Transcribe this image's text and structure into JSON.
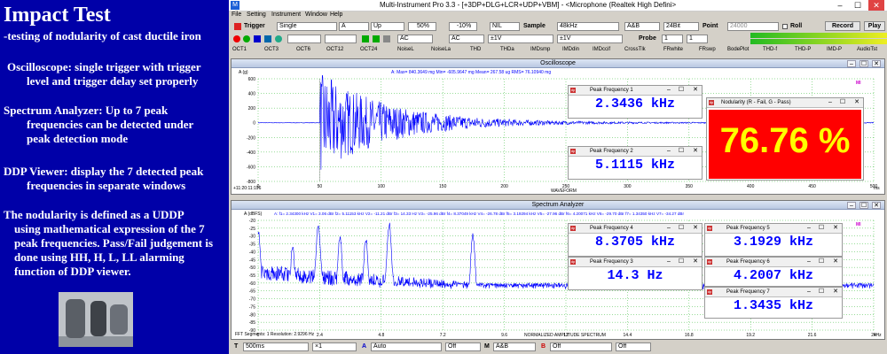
{
  "left_panel": {
    "title": "Impact Test",
    "subtitle": "-testing of nodularity of cast ductile iron",
    "osc_head": "Oscilloscope: single trigger with trigger",
    "osc_tail": "level and trigger delay set properly",
    "spec_head": "Spectrum Analyzer: Up to 7 peak",
    "spec_tail1": "frequencies can be detected under",
    "spec_tail2": "peak detection mode",
    "ddp_head": "DDP Viewer: display the 7 detected peak",
    "ddp_tail": "frequencies in separate windows",
    "nod_head": "The nodularity is defined as a UDDP",
    "nod_tail1": "using mathematical expression of the 7",
    "nod_tail2": "peak frequencies. Pass/Fail judgement is",
    "nod_tail3": "done using HH, H, L, LL alarming",
    "nod_tail4": "function of DDP viewer."
  },
  "titlebar": {
    "app_icon": "M",
    "title": "Multi-Instrument Pro 3.3    -  [+3DP+DLG+LCR+UDP+VBM]  -  <Microphone (Realtek High Defini>",
    "minimize": "–",
    "maximize": "☐",
    "close": "✕"
  },
  "menu": [
    "File",
    "Setting",
    "Instrument",
    "Window",
    "Help"
  ],
  "toolbar": {
    "trigger_label": "Trigger",
    "trigger_mode": "Single",
    "trigger_channel": "A",
    "trigger_edge": "Up",
    "trigger_level": "50%",
    "trigger_delay": "-10%",
    "nil": "NIL",
    "sample_label": "Sample",
    "sample_rate": "48kHz",
    "channels": "A&B",
    "bits": "24Bit",
    "point_label": "Point",
    "point_value": "24000",
    "roll_label": "Roll",
    "record_label": "Record",
    "play_label": "Play",
    "coupling_a": "AC",
    "coupling_b": "AC",
    "range_a": "±1V",
    "range_b": "±1V",
    "probe_label": "Probe",
    "probe_a": "1",
    "probe_b": "1"
  },
  "tabs": [
    "OCT1",
    "OCT3",
    "OCT6",
    "OCT12",
    "OCT24",
    "NoiseL",
    "NoiseLa",
    "THD",
    "THDa",
    "IMDsmp",
    "IMDdin",
    "IMDccif",
    "CrossTlk",
    "FRwhite",
    "FRswp",
    "BodePlot",
    "THD-f",
    "THD-P",
    "IMD-P",
    "AudioTst"
  ],
  "oscilloscope": {
    "title": "Oscilloscope",
    "ylabel": "A (g)",
    "readout": "A: Max=   840.3649 mg  Min=  -605.9647 mg  Mean=     267.58 ug  RMS=     76.10940 mg",
    "yticks": [
      "600",
      "400",
      "200",
      "0",
      "-200",
      "-400",
      "-600",
      "-800"
    ],
    "xticks": [
      "0",
      "50",
      "100",
      "150",
      "200",
      "250",
      "300",
      "350",
      "400",
      "450",
      "500"
    ],
    "xunit": "ms",
    "start_time": "+11:20:11:196",
    "footer": "WAVEFORM",
    "channel_marker": "MI"
  },
  "spectrum": {
    "title": "Spectrum Analyzer",
    "ylabel": "A (dBFS)",
    "readout": "A: f1=  2.34300  kHz V1=  3.06 dBr f2=  5.11153 kHz V2=  -11.21 dBr f3=  14.33  Hz V3=  -25.96 dBr f4=  8.37049  kHz V4=  -26.78 dBr f5=  3.19294  kHz V5=  -27.96 dBr f6=  4.20071  kHz V6=  -29.70 dBr f7=  1.34350  kHz V7=  -34.27 dBr",
    "yticks": [
      "-20",
      "-25",
      "-30",
      "-35",
      "-40",
      "-45",
      "-50",
      "-55",
      "-60",
      "-65",
      "-70",
      "-75",
      "-80",
      "-85",
      "-90"
    ],
    "xticks": [
      "0",
      "2.4",
      "4.8",
      "7.2",
      "9.6",
      "12",
      "14.4",
      "16.8",
      "19.2",
      "21.6",
      "24"
    ],
    "xunit": "kHz",
    "fft_info": "FFT Segments: 1    Resolution: 2.9296 Hz",
    "footer": "NORMALIZED AMPLITUDE SPECTRUM",
    "channel_marker": "MI"
  },
  "ddp": [
    {
      "title": "Peak Frequency 1",
      "value": "2.3436 kHz"
    },
    {
      "title": "Peak Frequency 2",
      "value": "5.1115 kHz"
    },
    {
      "title": "Peak Frequency 4",
      "value": "8.3705 kHz"
    },
    {
      "title": "Peak Frequency 5",
      "value": "3.1929 kHz"
    },
    {
      "title": "Peak Frequency 3",
      "value": "14.3  Hz"
    },
    {
      "title": "Peak Frequency 6",
      "value": "4.2007 kHz"
    },
    {
      "title": "Peak Frequency 7",
      "value": "1.3435 kHz"
    }
  ],
  "nodularity": {
    "title": "Nodularity  (R - Fail, G - Pass)",
    "value": "76.76 %",
    "status_color": "#ff0000"
  },
  "statusbar": {
    "t_label": "T",
    "timebase": "500ms",
    "mult": "×1",
    "a_label": "A",
    "a_scale": "Auto",
    "a_offset": "Off",
    "m_label": "M",
    "m_mode": "A&B",
    "b_label": "B",
    "b_scale": "Off",
    "b_offset": "Off"
  },
  "colors": {
    "panel_bg": "#00008b",
    "trace": "#0000ff",
    "grid": "#00aa00",
    "ddp_value": "#0000ff"
  }
}
